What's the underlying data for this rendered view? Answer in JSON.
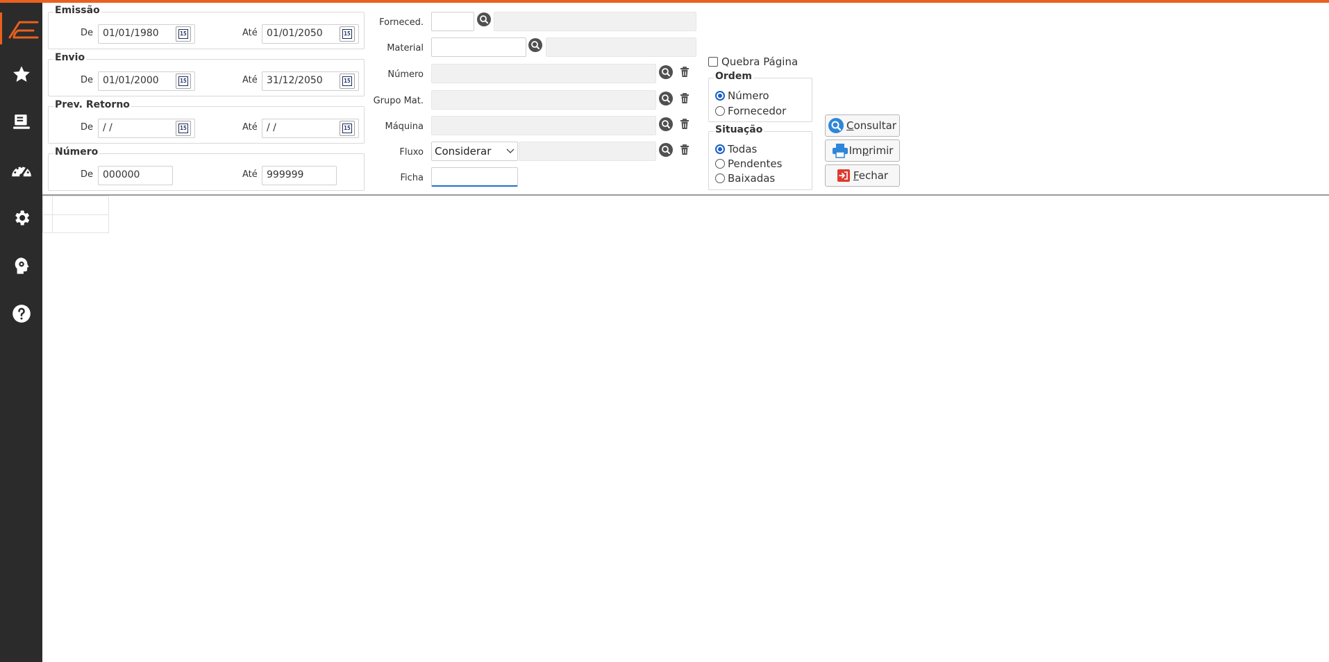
{
  "colors": {
    "accent": "#e8611f",
    "sidebar": "#2b2b2b",
    "focus": "#1f6fd1"
  },
  "sidebar": {
    "icons": [
      "logo-icon",
      "star-icon",
      "monitor-icon",
      "dashboard-icon",
      "gear-icon",
      "brain-gear-icon",
      "help-icon"
    ]
  },
  "emissao": {
    "title": "Emissão",
    "de_label": "De",
    "de_value": "01/01/1980",
    "ate_label": "Até",
    "ate_value": "01/01/2050"
  },
  "envio": {
    "title": "Envio",
    "de_label": "De",
    "de_value": "01/01/2000",
    "ate_label": "Até",
    "ate_value": "31/12/2050"
  },
  "prev_retorno": {
    "title": "Prev. Retorno",
    "de_label": "De",
    "de_value": " /  /",
    "ate_label": "Até",
    "ate_value": " /  /"
  },
  "numero_group": {
    "title": "Número",
    "de_label": "De",
    "de_value": "000000",
    "ate_label": "Até",
    "ate_value": "999999"
  },
  "calendar_icon_text": "15",
  "fields": {
    "forneced": "Forneced.",
    "material": "Material",
    "numero": "Número",
    "grupo_mat": "Grupo Mat.",
    "maquina": "Máquina",
    "fluxo": "Fluxo",
    "fluxo_value": "Considerar",
    "ficha": "Ficha"
  },
  "quebra_pagina": "Quebra Página",
  "ordem": {
    "title": "Ordem",
    "options": [
      "Número",
      "Fornecedor"
    ],
    "selected": "Número"
  },
  "situacao": {
    "title": "Situação",
    "options": [
      "Todas",
      "Pendentes",
      "Baixadas"
    ],
    "selected": "Todas"
  },
  "buttons": {
    "consultar_prefix": "C",
    "consultar_rest": "onsultar",
    "imprimir_pre": "Im",
    "imprimir_key": "p",
    "imprimir_rest": "rimir",
    "fechar_prefix": "F",
    "fechar_rest": "echar"
  }
}
